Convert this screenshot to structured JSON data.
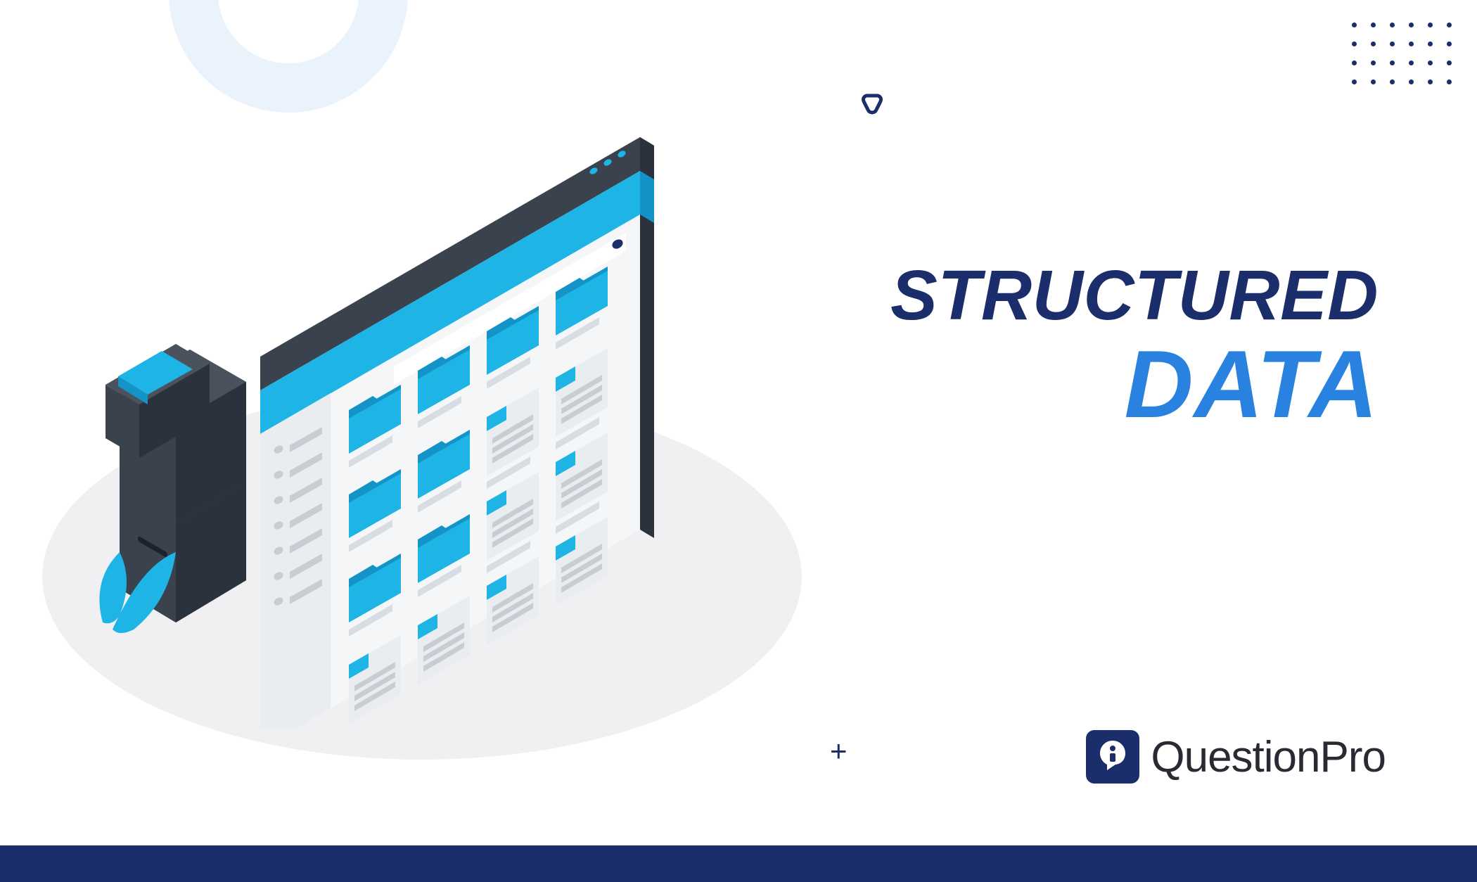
{
  "title": {
    "line1": "STRUCTURED",
    "line2": "DATA"
  },
  "brand": {
    "name": "QuestionPro"
  },
  "colors": {
    "primary_dark": "#1b2d6b",
    "primary_blue": "#2982e0",
    "accent_cyan": "#1eb4e6",
    "dark_gray": "#3a424d",
    "light_gray": "#d8dde3"
  }
}
